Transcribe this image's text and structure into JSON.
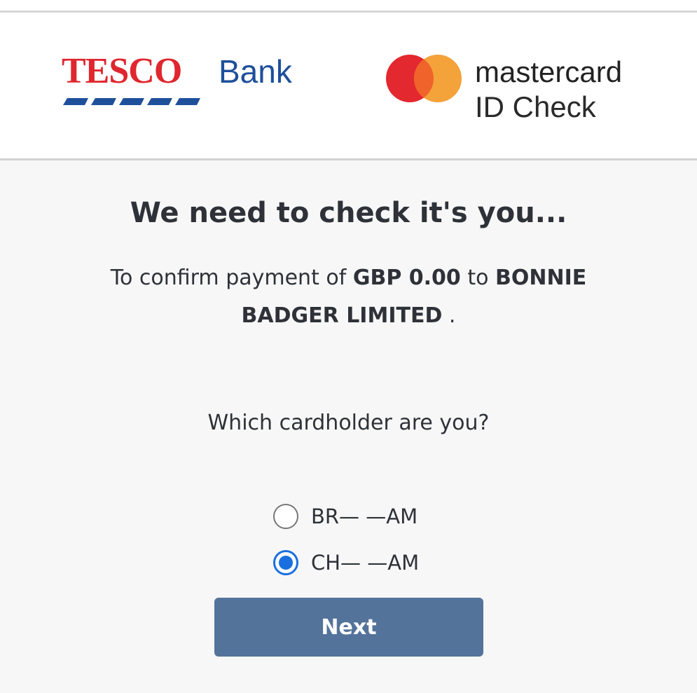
{
  "header": {
    "tesco_logo_text": "TESCO",
    "bank_logo_text": "Bank",
    "mastercard_text": "mastercard",
    "id_check_text": "ID Check"
  },
  "main": {
    "title": "We need to check it's you...",
    "confirm": {
      "prefix": "To confirm payment of ",
      "amount": "GBP 0.00",
      "middle": " to ",
      "merchant": "BONNIE BADGER LIMITED",
      "suffix": " ."
    },
    "question": "Which cardholder are you?",
    "options": [
      {
        "label": "BR— —AM",
        "selected": false
      },
      {
        "label": "CH— —AM",
        "selected": true
      }
    ],
    "next_label": "Next"
  },
  "colors": {
    "tesco_red": "#e0262e",
    "tesco_blue": "#1e4f9b",
    "mastercard_red": "#eb001b",
    "mastercard_orange": "#f79e1b",
    "radio_selected": "#1a6fe0",
    "button_bg": "#54739a"
  }
}
